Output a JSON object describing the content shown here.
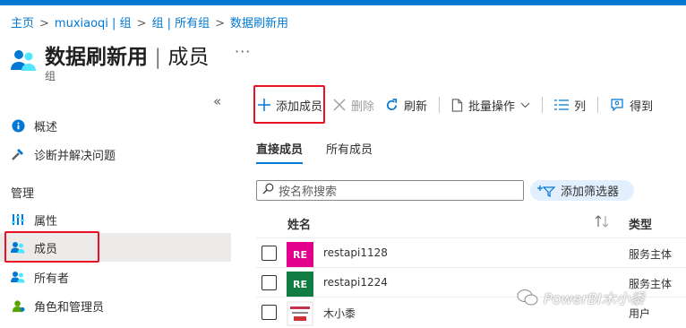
{
  "breadcrumb": [
    "主页",
    "muxiaoqi | 组",
    "组 | 所有组",
    "数据刷新用"
  ],
  "breadcrumb_sep": ">",
  "header": {
    "title_main": "数据刷新用",
    "title_sep": " | ",
    "title_section": "成员",
    "more": "···",
    "subtitle": "组"
  },
  "sidebar": {
    "collapse_glyph": "«",
    "items": [
      {
        "label": "概述",
        "icon": "info-icon"
      },
      {
        "label": "诊断并解决问题",
        "icon": "wrench-icon"
      }
    ],
    "section_header": "管理",
    "manage_items": [
      {
        "label": "属性",
        "icon": "properties-icon"
      },
      {
        "label": "成员",
        "icon": "members-icon",
        "selected": true
      },
      {
        "label": "所有者",
        "icon": "owners-icon"
      },
      {
        "label": "角色和管理员",
        "icon": "roles-icon"
      }
    ]
  },
  "toolbar": {
    "add": "添加成员",
    "delete": "删除",
    "refresh": "刷新",
    "bulk": "批量操作",
    "columns": "列",
    "feedback": "得到"
  },
  "tabs": [
    "直接成员",
    "所有成员"
  ],
  "search": {
    "placeholder": "按名称搜索"
  },
  "filter_button": "添加筛选器",
  "table": {
    "columns": {
      "name": "姓名",
      "type": "类型"
    },
    "rows": [
      {
        "initials": "RE",
        "name": "restapi1128",
        "type": "服务主体",
        "color": "#e3008c"
      },
      {
        "initials": "RE",
        "name": "restapi1224",
        "type": "服务主体",
        "color": "#107c41"
      },
      {
        "initials": "",
        "name": "木小黍",
        "type": "用户",
        "color": "#ffffff"
      }
    ]
  },
  "colors": {
    "accent": "#0078d4",
    "highlight": "#e81123"
  },
  "watermark": "PowerBI木小黍"
}
